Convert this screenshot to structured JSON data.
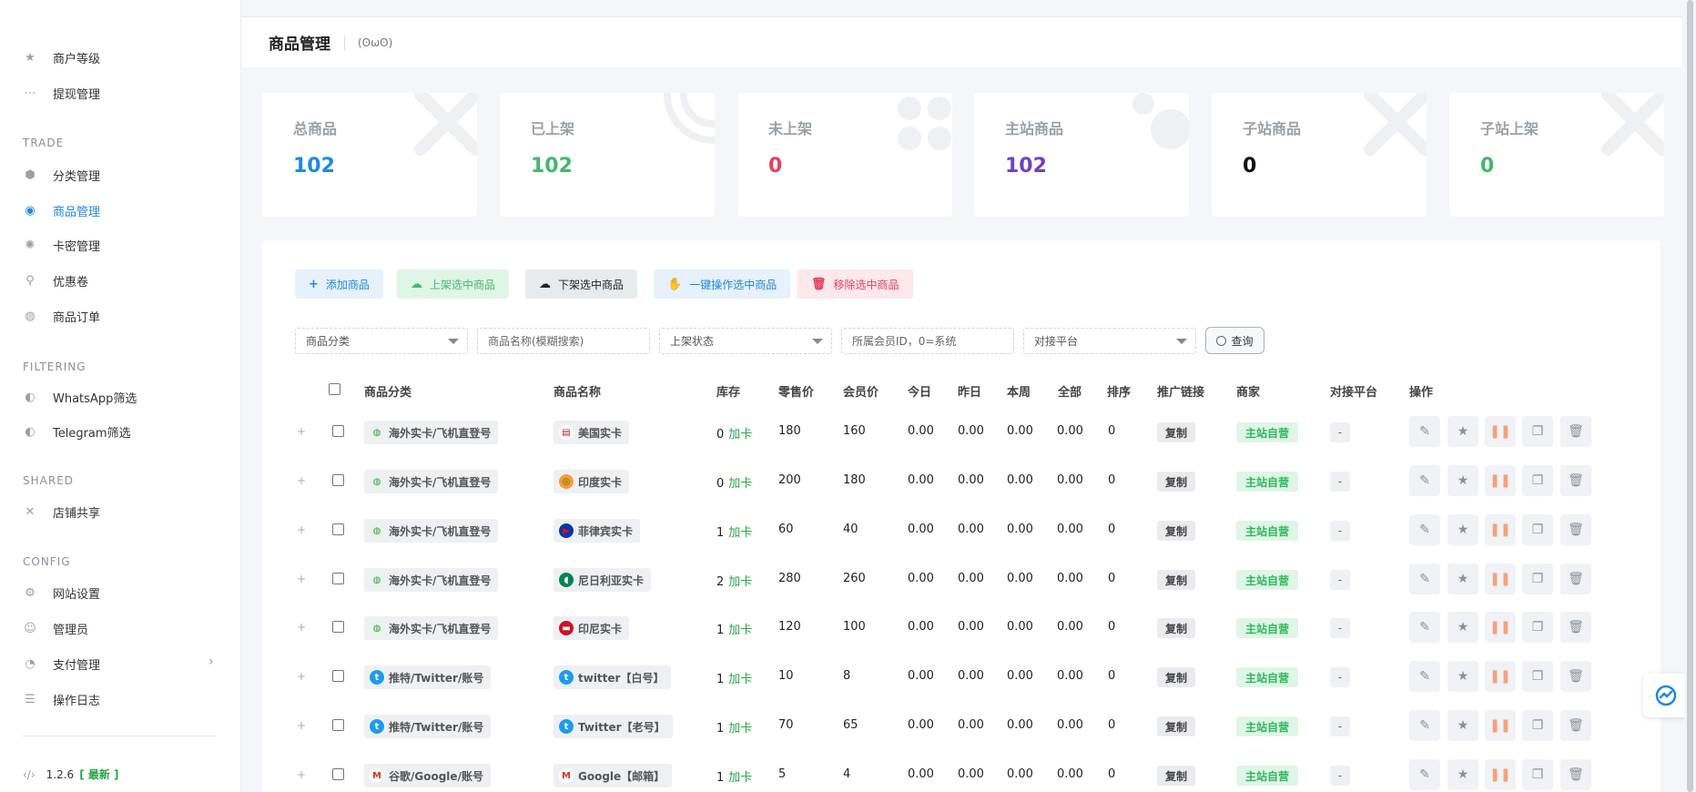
{
  "sidebar": {
    "items_top": [
      {
        "label": "商户等级",
        "icon": "star-icon"
      },
      {
        "label": "提现管理",
        "icon": "dots-icon"
      }
    ],
    "sections": [
      {
        "heading": "TRADE",
        "items": [
          {
            "label": "分类管理",
            "icon": "cube-icon"
          },
          {
            "label": "商品管理",
            "icon": "product-icon",
            "active": true
          },
          {
            "label": "卡密管理",
            "icon": "gear-icon"
          },
          {
            "label": "优惠卷",
            "icon": "link-icon"
          },
          {
            "label": "商品订单",
            "icon": "globe-icon"
          }
        ]
      },
      {
        "heading": "FILTERING",
        "items": [
          {
            "label": "WhatsApp筛选",
            "icon": "whatsapp-icon"
          },
          {
            "label": "Telegram筛选",
            "icon": "telegram-icon"
          }
        ]
      },
      {
        "heading": "SHARED",
        "items": [
          {
            "label": "店铺共享",
            "icon": "share-icon"
          }
        ]
      },
      {
        "heading": "CONFIG",
        "items": [
          {
            "label": "网站设置",
            "icon": "settings-icon"
          },
          {
            "label": "管理员",
            "icon": "users-icon"
          },
          {
            "label": "支付管理",
            "icon": "payment-icon",
            "arrow": "›"
          },
          {
            "label": "操作日志",
            "icon": "log-icon"
          }
        ]
      }
    ],
    "version": {
      "code_icon": "‹/›",
      "number": "1.2.6",
      "latest": "[ 最新 ]"
    }
  },
  "header": {
    "title": "商品管理",
    "face": "(ʘωʘ)"
  },
  "stats": [
    {
      "label": "总商品",
      "value": "102",
      "color": "#1e88e5"
    },
    {
      "label": "已上架",
      "value": "102",
      "color": "#43b86b"
    },
    {
      "label": "未上架",
      "value": "0",
      "color": "#e63e5c"
    },
    {
      "label": "主站商品",
      "value": "102",
      "color": "#6f42c1"
    },
    {
      "label": "子站商品",
      "value": "0",
      "color": "#111111"
    },
    {
      "label": "子站上架",
      "value": "0",
      "color": "#43b86b"
    }
  ],
  "toolbar": {
    "add": "添加商品",
    "list": "上架选中商品",
    "unlist": "下架选中商品",
    "batch": "一键操作选中商品",
    "remove": "移除选中商品"
  },
  "filters": {
    "category": "商品分类",
    "name_placeholder": "商品名称(模糊搜索)",
    "status": "上架状态",
    "member_placeholder": "所属会员ID，0=系统",
    "platform": "对接平台",
    "search": "查询"
  },
  "table": {
    "headers": [
      "商品分类",
      "商品名称",
      "库存",
      "零售价",
      "会员价",
      "今日",
      "昨日",
      "本周",
      "全部",
      "排序",
      "推广链接",
      "商家",
      "对接平台",
      "操作"
    ],
    "add_card_label": "加卡",
    "copy_label": "复制",
    "merchant_label": "主站自营",
    "platform_label": "-",
    "expand_label": "+",
    "rows": [
      {
        "category": "海外实卡/飞机直登号",
        "cat_icon": "globe",
        "name": "美国实卡",
        "name_icon": "flag-us",
        "stock": "0",
        "retail": "180",
        "member": "160",
        "today": "0.00",
        "yesterday": "0.00",
        "week": "0.00",
        "all": "0.00",
        "sort": "0"
      },
      {
        "category": "海外实卡/飞机直登号",
        "cat_icon": "globe",
        "name": "印度实卡",
        "name_icon": "flag-in",
        "stock": "0",
        "retail": "200",
        "member": "180",
        "today": "0.00",
        "yesterday": "0.00",
        "week": "0.00",
        "all": "0.00",
        "sort": "0"
      },
      {
        "category": "海外实卡/飞机直登号",
        "cat_icon": "globe",
        "name": "菲律宾实卡",
        "name_icon": "flag-ph",
        "stock": "1",
        "retail": "60",
        "member": "40",
        "today": "0.00",
        "yesterday": "0.00",
        "week": "0.00",
        "all": "0.00",
        "sort": "0"
      },
      {
        "category": "海外实卡/飞机直登号",
        "cat_icon": "globe",
        "name": "尼日利亚实卡",
        "name_icon": "flag-ng",
        "stock": "2",
        "retail": "280",
        "member": "260",
        "today": "0.00",
        "yesterday": "0.00",
        "week": "0.00",
        "all": "0.00",
        "sort": "0"
      },
      {
        "category": "海外实卡/飞机直登号",
        "cat_icon": "globe",
        "name": "印尼实卡",
        "name_icon": "flag-id",
        "stock": "1",
        "retail": "120",
        "member": "100",
        "today": "0.00",
        "yesterday": "0.00",
        "week": "0.00",
        "all": "0.00",
        "sort": "0"
      },
      {
        "category": "推特/Twitter/账号",
        "cat_icon": "twitter",
        "name": "twitter【白号】",
        "name_icon": "twitter",
        "stock": "1",
        "retail": "10",
        "member": "8",
        "today": "0.00",
        "yesterday": "0.00",
        "week": "0.00",
        "all": "0.00",
        "sort": "0"
      },
      {
        "category": "推特/Twitter/账号",
        "cat_icon": "twitter",
        "name": "Twitter【老号】",
        "name_icon": "twitter",
        "stock": "1",
        "retail": "70",
        "member": "65",
        "today": "0.00",
        "yesterday": "0.00",
        "week": "0.00",
        "all": "0.00",
        "sort": "0"
      },
      {
        "category": "谷歌/Google/账号",
        "cat_icon": "gmail",
        "name": "Google【邮箱】",
        "name_icon": "gmail",
        "stock": "1",
        "retail": "5",
        "member": "4",
        "today": "0.00",
        "yesterday": "0.00",
        "week": "0.00",
        "all": "0.00",
        "sort": "0"
      }
    ]
  }
}
